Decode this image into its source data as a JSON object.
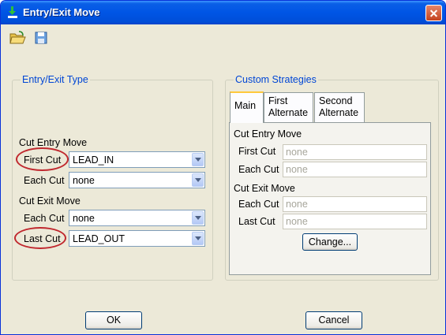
{
  "window": {
    "title": "Entry/Exit Move"
  },
  "toolbar": {
    "open_icon": "folder-open-icon",
    "save_icon": "floppy-disk-icon"
  },
  "entry_exit_type": {
    "legend": "Entry/Exit Type",
    "cut_entry_heading": "Cut Entry Move",
    "first_cut_label": "First Cut",
    "first_cut_value": "LEAD_IN",
    "each_cut_entry_label": "Each Cut",
    "each_cut_entry_value": "none",
    "cut_exit_heading": "Cut Exit Move",
    "each_cut_exit_label": "Each Cut",
    "each_cut_exit_value": "none",
    "last_cut_label": "Last Cut",
    "last_cut_value": "LEAD_OUT"
  },
  "custom_strategies": {
    "legend": "Custom Strategies",
    "tabs": [
      {
        "line1": "Main",
        "line2": ""
      },
      {
        "line1": "First",
        "line2": "Alternate"
      },
      {
        "line1": "Second",
        "line2": "Alternate"
      }
    ],
    "cut_entry_heading": "Cut Entry Move",
    "first_cut_label": "First Cut",
    "first_cut_value": "none",
    "each_cut_entry_label": "Each Cut",
    "each_cut_entry_value": "none",
    "cut_exit_heading": "Cut Exit Move",
    "each_cut_exit_label": "Each Cut",
    "each_cut_exit_value": "none",
    "last_cut_label": "Last Cut",
    "last_cut_value": "none",
    "change_button": "Change..."
  },
  "buttons": {
    "ok": "OK",
    "cancel": "Cancel"
  },
  "colors": {
    "annotation_ring": "#c0282e",
    "group_legend": "#0046d5"
  }
}
